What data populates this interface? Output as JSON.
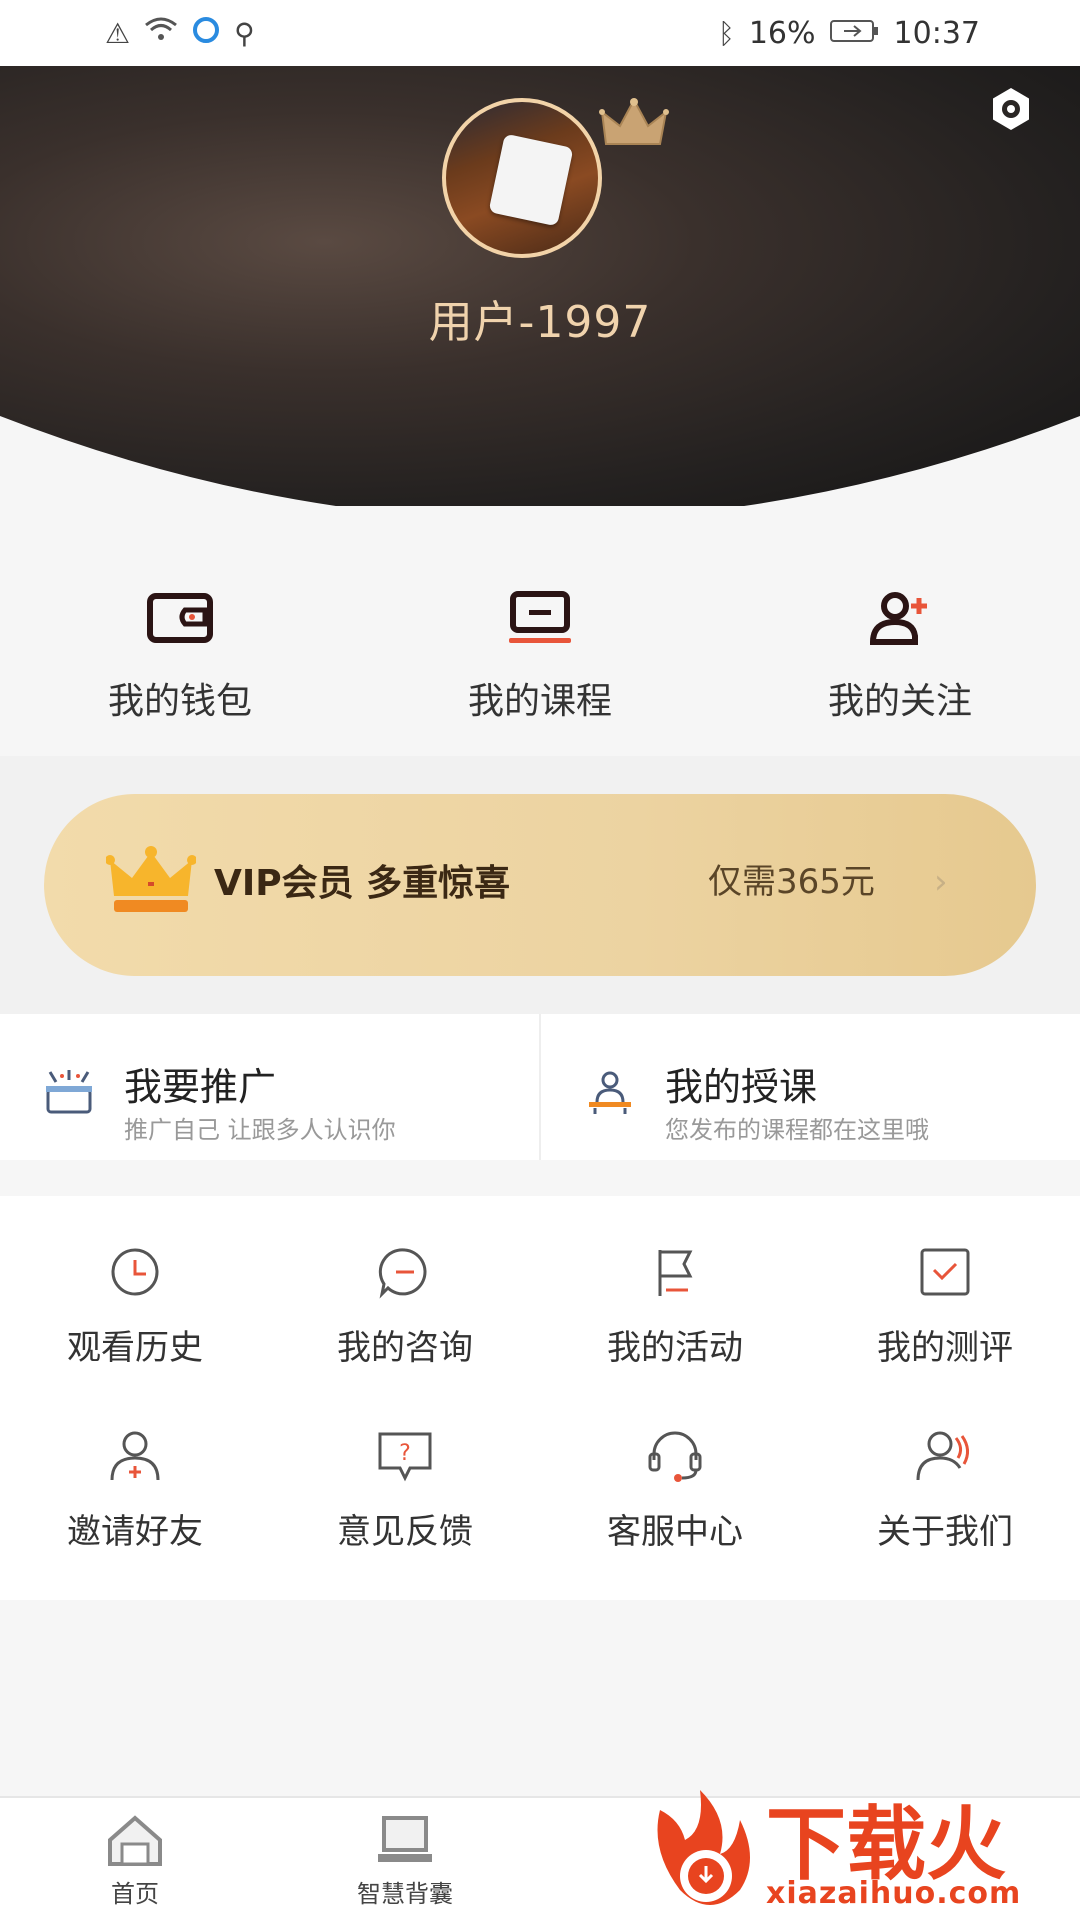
{
  "status_bar": {
    "battery": "16%",
    "time": "10:37"
  },
  "profile": {
    "username": "用户-1997"
  },
  "quick_actions": [
    {
      "label": "我的钱包",
      "icon": "wallet-icon"
    },
    {
      "label": "我的课程",
      "icon": "course-icon"
    },
    {
      "label": "我的关注",
      "icon": "follow-icon"
    }
  ],
  "vip": {
    "title": "VIP会员 多重惊喜",
    "price": "仅需365元",
    "chevron": "›"
  },
  "promo": [
    {
      "title": "我要推广",
      "subtitle": "推广自己 让跟多人认识你",
      "icon": "promote-icon"
    },
    {
      "title": "我的授课",
      "subtitle": "您发布的课程都在这里哦",
      "icon": "teach-icon"
    }
  ],
  "menu": [
    {
      "label": "观看历史",
      "icon": "clock-icon"
    },
    {
      "label": "我的咨询",
      "icon": "consult-icon"
    },
    {
      "label": "我的活动",
      "icon": "flag-icon"
    },
    {
      "label": "我的测评",
      "icon": "check-icon"
    },
    {
      "label": "邀请好友",
      "icon": "invite-icon"
    },
    {
      "label": "意见反馈",
      "icon": "feedback-icon"
    },
    {
      "label": "客服中心",
      "icon": "headset-icon"
    },
    {
      "label": "关于我们",
      "icon": "about-icon"
    }
  ],
  "bottom_nav": [
    {
      "label": "首页",
      "icon": "home-icon"
    },
    {
      "label": "智慧背囊",
      "icon": "laptop-icon"
    }
  ],
  "watermark": {
    "main": "下载火",
    "url": "xiazaihuo.com"
  },
  "colors": {
    "accent": "#e8441f",
    "gold": "#f0d3ad",
    "vip_bg": "#ecd3a1"
  }
}
